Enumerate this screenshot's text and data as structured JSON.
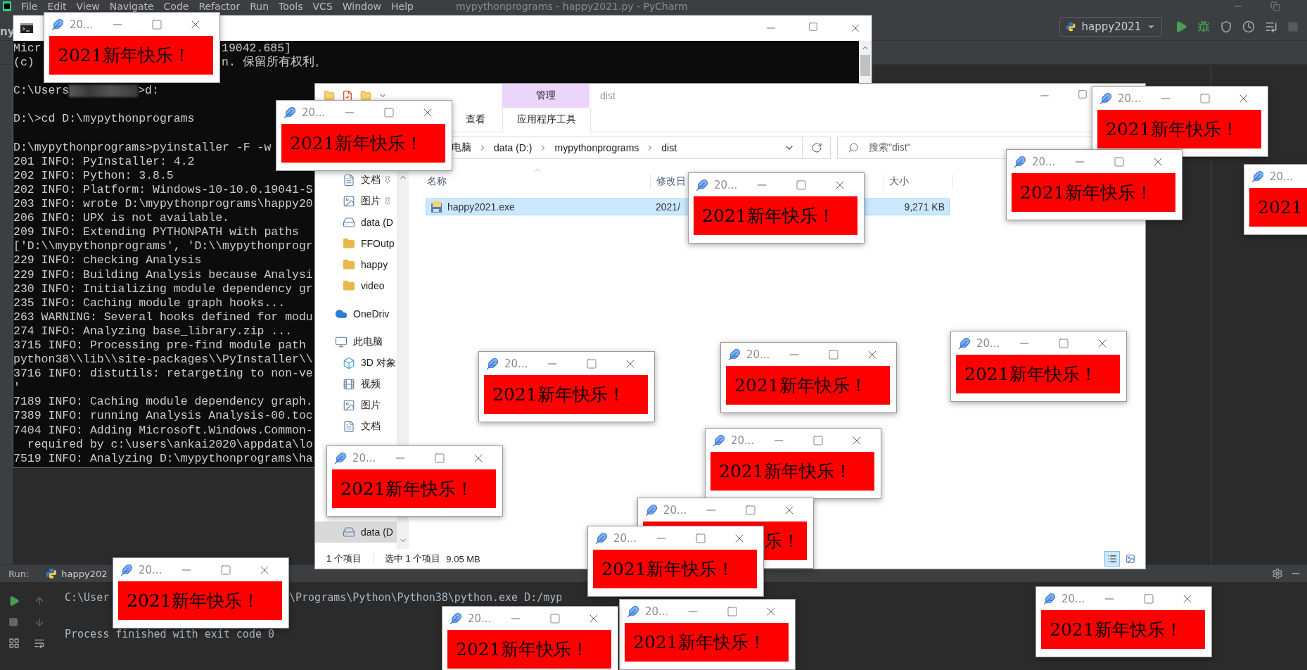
{
  "ide": {
    "menu": [
      "File",
      "Edit",
      "View",
      "Navigate",
      "Code",
      "Refactor",
      "Run",
      "Tools",
      "VCS",
      "Window",
      "Help"
    ],
    "title": "mypythonprograms - happy2021.py - PyCharm",
    "project": "ny",
    "run_config": "happy2021",
    "run_panel": {
      "label": "Run:",
      "tab": "happy202",
      "lines": [
        {
          "parts": [
            "C:\\User",
            "\\Programs\\Python\\Python38\\python.exe D:/myp"
          ]
        },
        {
          "parts": [
            "Process finished with exit code 0"
          ],
          "blank_before": true
        }
      ]
    }
  },
  "console": {
    "lines": [
      {
        "parts": [
          "Micr",
          "19042.685]"
        ]
      },
      {
        "parts": [
          "(c)",
          "n. 保留所有权利。"
        ]
      },
      {
        "parts": [
          "C:\\Users",
          ">d:"
        ],
        "redacted": true,
        "blank_before": true
      },
      {
        "parts": [
          "D:\\>cd D:\\mypythonprograms"
        ],
        "blank_before": true
      },
      {
        "parts": [
          "D:\\mypythonprograms>pyinstaller -F -w"
        ],
        "blank_before": true
      },
      {
        "parts": [
          "201 INFO: PyInstaller: 4.2"
        ]
      },
      {
        "parts": [
          "202 INFO: Python: 3.8.5"
        ]
      },
      {
        "parts": [
          "202 INFO: Platform: Windows-10-10.0.19041-S"
        ]
      },
      {
        "parts": [
          "203 INFO: wrote D:\\mypythonprograms\\happy20"
        ]
      },
      {
        "parts": [
          "206 INFO: UPX is not available."
        ]
      },
      {
        "parts": [
          "209 INFO: Extending PYTHONPATH with paths"
        ]
      },
      {
        "parts": [
          "['D:\\\\mypythonprograms', 'D:\\\\mypythonprogr"
        ]
      },
      {
        "parts": [
          "229 INFO: checking Analysis"
        ]
      },
      {
        "parts": [
          "229 INFO: Building Analysis because Analysi"
        ]
      },
      {
        "parts": [
          "230 INFO: Initializing module dependency gr"
        ]
      },
      {
        "parts": [
          "235 INFO: Caching module graph hooks..."
        ]
      },
      {
        "parts": [
          "263 WARNING: Several hooks defined for modu"
        ]
      },
      {
        "parts": [
          "274 INFO: Analyzing base_library.zip ..."
        ]
      },
      {
        "parts": [
          "3715 INFO: Processing pre-find module path"
        ]
      },
      {
        "parts": [
          "python38\\\\lib\\\\site-packages\\\\PyInstaller\\\\"
        ]
      },
      {
        "parts": [
          "3716 INFO: distutils: retargeting to non-ve"
        ]
      },
      {
        "parts": [
          "'"
        ]
      },
      {
        "parts": [
          "7189 INFO: Caching module dependency graph."
        ]
      },
      {
        "parts": [
          "7389 INFO: running Analysis Analysis-00.toc"
        ]
      },
      {
        "parts": [
          "7404 INFO: Adding Microsoft.Windows.Common-"
        ]
      },
      {
        "parts": [
          "  required by c:\\users\\ankai2020\\appdata\\lo"
        ]
      },
      {
        "parts": [
          "7519 INFO: Analyzing D:\\mypythonprograms\\ha"
        ]
      }
    ]
  },
  "explorer": {
    "context_tab": "管理",
    "title": "dist",
    "view_tab": "查看",
    "tool_tab": "应用程序工具",
    "breadcrumb": [
      "电脑",
      "data (D:)",
      "mypythonprograms",
      "dist"
    ],
    "search": {
      "placeholder": "搜索\"dist\""
    },
    "nav": [
      {
        "label": "文档",
        "kind": "item",
        "pinned": true,
        "selected": false
      },
      {
        "label": "图片",
        "kind": "item",
        "pinned": true,
        "selected": false
      },
      {
        "label": "data (D",
        "kind": "item",
        "pinned": false,
        "selected": false
      },
      {
        "label": "FFOutp",
        "kind": "item",
        "pinned": false,
        "selected": false
      },
      {
        "label": "happy",
        "kind": "item",
        "pinned": false,
        "selected": false
      },
      {
        "label": "video",
        "kind": "item",
        "pinned": false,
        "selected": false
      },
      {
        "label": "OneDriv",
        "kind": "root",
        "pinned": false,
        "selected": false
      },
      {
        "label": "此电脑",
        "kind": "root",
        "pinned": false,
        "selected": false,
        "children": [
          {
            "label": "3D 对象",
            "selected": false
          },
          {
            "label": "视频",
            "selected": false
          },
          {
            "label": "图片",
            "selected": false
          },
          {
            "label": "文档",
            "selected": false
          },
          {
            "label": "data (D",
            "selected": true
          }
        ]
      }
    ],
    "columns": [
      "名称",
      "修改日",
      "大小"
    ],
    "files": [
      {
        "name": "happy2021.exe",
        "modified": "2021/",
        "size": "9,271 KB",
        "selected": true
      }
    ],
    "status": {
      "count": "1 个项目",
      "selection": "选中 1 个项目",
      "size": "9.05 MB"
    }
  },
  "popups": [
    {
      "title": "20...",
      "message": "2021新年快乐！"
    },
    {
      "title": "20...",
      "message": "2021新年快乐！"
    },
    {
      "title": "20...",
      "message": "2021新年快乐！"
    },
    {
      "title": "20...",
      "message": "2021新年快乐！"
    },
    {
      "title": "20...",
      "message": "2021"
    },
    {
      "title": "20...",
      "message": "2021新年快乐！"
    },
    {
      "title": "20...",
      "message": "2021新年快乐！"
    },
    {
      "title": "20...",
      "message": "2021新年快乐！"
    },
    {
      "title": "20...",
      "message": "2021新年快乐！"
    },
    {
      "title": "20...",
      "message": "2021新年快乐！"
    },
    {
      "title": "20...",
      "message": "2021新年快乐！"
    },
    {
      "title": "20...",
      "message": "乐！"
    },
    {
      "title": "20...",
      "message": "2021新年快乐！"
    },
    {
      "title": "20...",
      "message": "2021新年快乐！"
    },
    {
      "title": "20...",
      "message": "2021新年快乐！"
    },
    {
      "title": "20...",
      "message": "2021新年快乐！"
    },
    {
      "title": "20...",
      "message": "2021新年快乐！"
    }
  ]
}
